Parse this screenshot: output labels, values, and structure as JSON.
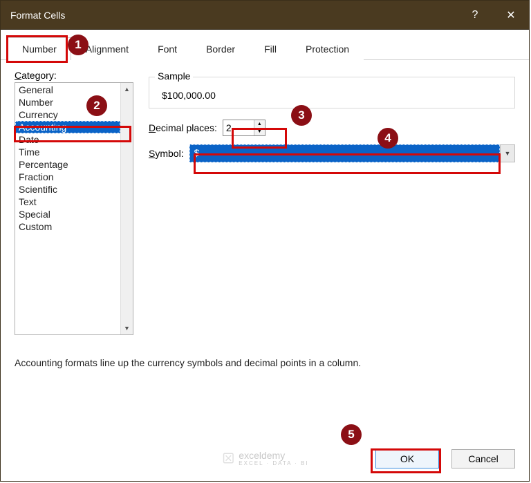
{
  "window": {
    "title": "Format Cells",
    "help_glyph": "?",
    "close_glyph": "✕"
  },
  "tabs": [
    {
      "label": "Number",
      "active": true
    },
    {
      "label": "Alignment",
      "active": false
    },
    {
      "label": "Font",
      "active": false
    },
    {
      "label": "Border",
      "active": false
    },
    {
      "label": "Fill",
      "active": false
    },
    {
      "label": "Protection",
      "active": false
    }
  ],
  "category": {
    "label_pre": "C",
    "label_rest": "ategory:",
    "items": [
      {
        "label": "General",
        "selected": false
      },
      {
        "label": "Number",
        "selected": false
      },
      {
        "label": "Currency",
        "selected": false
      },
      {
        "label": "Accounting",
        "selected": true
      },
      {
        "label": "Date",
        "selected": false
      },
      {
        "label": "Time",
        "selected": false
      },
      {
        "label": "Percentage",
        "selected": false
      },
      {
        "label": "Fraction",
        "selected": false
      },
      {
        "label": "Scientific",
        "selected": false
      },
      {
        "label": "Text",
        "selected": false
      },
      {
        "label": "Special",
        "selected": false
      },
      {
        "label": "Custom",
        "selected": false
      }
    ]
  },
  "sample": {
    "legend": "Sample",
    "value": "$100,000.00"
  },
  "decimal": {
    "label_pre": "D",
    "label_rest": "ecimal places:",
    "value": "2"
  },
  "symbol": {
    "label_pre": "S",
    "label_rest": "ymbol:",
    "value": "$"
  },
  "description": "Accounting formats line up the currency symbols and decimal points in a column.",
  "buttons": {
    "ok": "OK",
    "cancel": "Cancel"
  },
  "annotations": {
    "badges": [
      "1",
      "2",
      "3",
      "4",
      "5"
    ],
    "watermark_main": "exceldemy",
    "watermark_sub": "EXCEL · DATA · BI"
  }
}
